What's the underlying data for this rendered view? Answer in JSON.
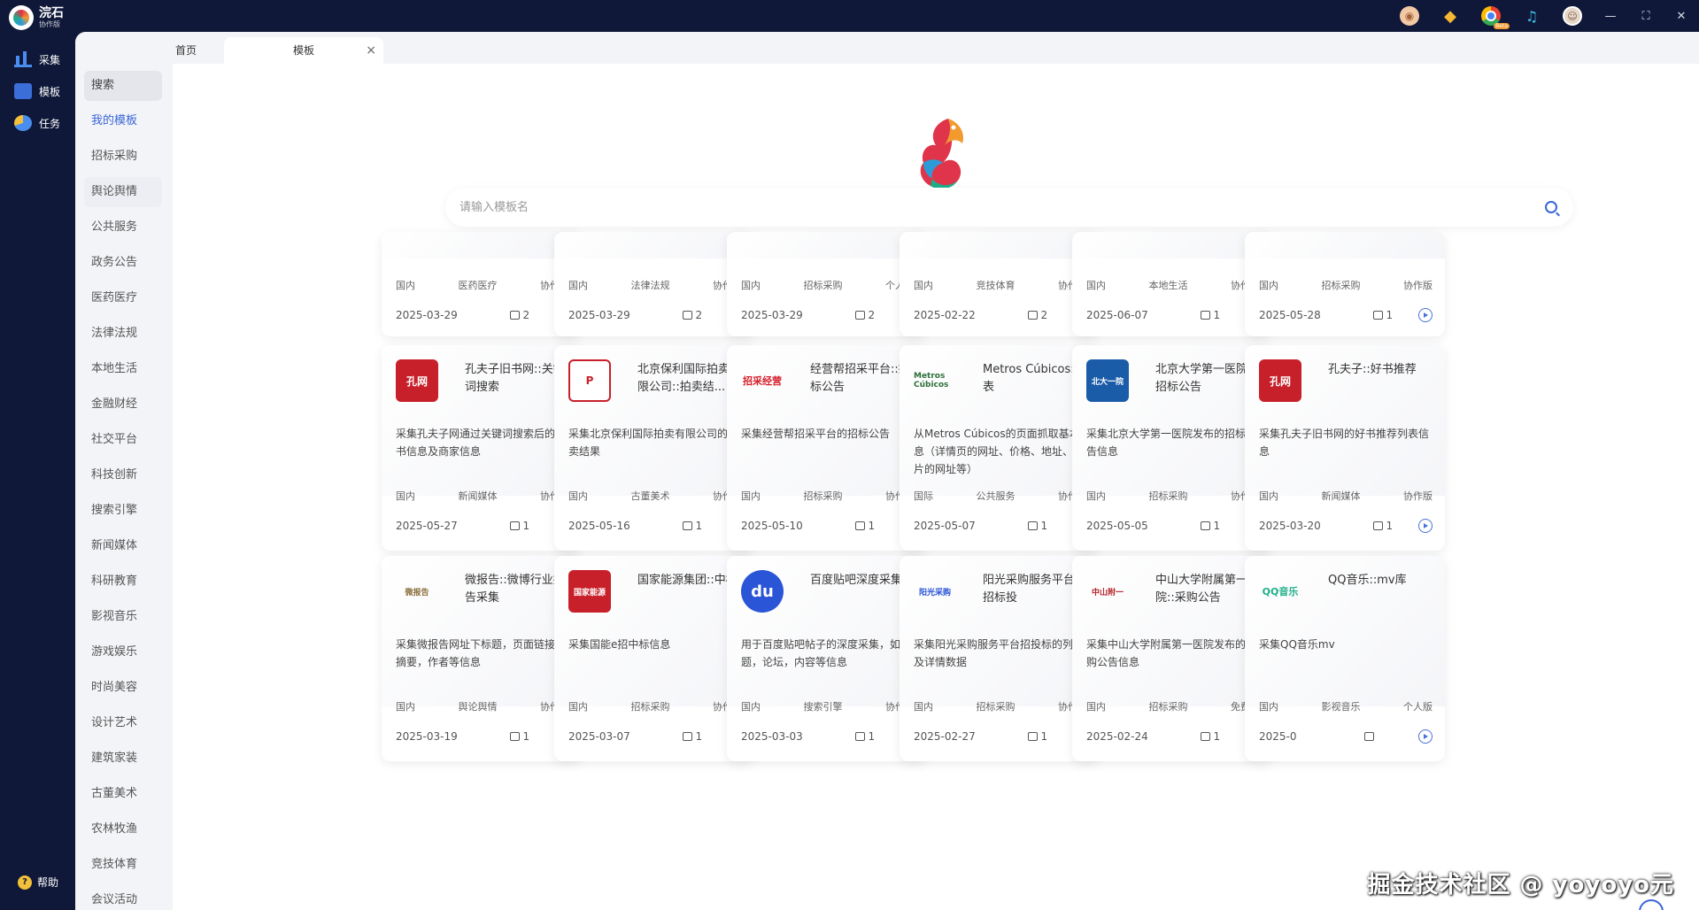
{
  "app": {
    "name": "浣石",
    "sub": "协作版"
  },
  "nav": [
    {
      "label": "采集",
      "icon": "chart-icon"
    },
    {
      "label": "模板",
      "icon": "template-icon"
    },
    {
      "label": "任务",
      "icon": "task-icon"
    }
  ],
  "help_label": "帮助",
  "tabs": {
    "home": "首页",
    "template": "模板",
    "close": "×"
  },
  "categories": [
    "搜索",
    "我的模板",
    "招标采购",
    "舆论舆情",
    "公共服务",
    "政务公告",
    "医药医疗",
    "法律法规",
    "本地生活",
    "金融财经",
    "社交平台",
    "科技创新",
    "搜索引擎",
    "新闻媒体",
    "科研教育",
    "影视音乐",
    "游戏娱乐",
    "时尚美容",
    "设计艺术",
    "建筑家装",
    "古董美术",
    "农林牧渔",
    "竞技体育",
    "会议活动"
  ],
  "search": {
    "placeholder": "请输入模板名"
  },
  "row0": [
    {
      "tags": [
        "国内",
        "医药医疗",
        "协作版"
      ],
      "date": "2025-03-29",
      "likes": "2"
    },
    {
      "tags": [
        "国内",
        "法律法规",
        "协作版"
      ],
      "date": "2025-03-29",
      "likes": "2"
    },
    {
      "tags": [
        "国内",
        "招标采购",
        "个人版"
      ],
      "date": "2025-03-29",
      "likes": "2"
    },
    {
      "tags": [
        "国内",
        "竞技体育",
        "协作版"
      ],
      "date": "2025-02-22",
      "likes": "2"
    },
    {
      "tags": [
        "国内",
        "本地生活",
        "协作版"
      ],
      "date": "2025-06-07",
      "likes": "1"
    },
    {
      "tags": [
        "国内",
        "招标采购",
        "协作版"
      ],
      "date": "2025-05-28",
      "likes": "1"
    }
  ],
  "row1": [
    {
      "logo": "孔网",
      "title": "孔夫子旧书网::关键词搜索",
      "desc": "采集孔夫子网通过关键词搜索后的图书信息及商家信息",
      "tags": [
        "国内",
        "新闻媒体",
        "协作版"
      ],
      "date": "2025-05-27",
      "likes": "1"
    },
    {
      "logo": "P",
      "title": "北京保利国际拍卖有限公司::拍卖结...",
      "desc": "采集北京保利国际拍卖有限公司的拍卖结果",
      "tags": [
        "国内",
        "古董美术",
        "协作版"
      ],
      "date": "2025-05-16",
      "likes": "1"
    },
    {
      "logo": "招采经营",
      "title": "经营帮招采平台::招标公告",
      "desc": "采集经营帮招采平台的招标公告",
      "tags": [
        "国内",
        "招标采购",
        "协作版"
      ],
      "date": "2025-05-10",
      "likes": "1"
    },
    {
      "logo": "Metros Cúbicos",
      "title": "Metros Cúbicos::列表",
      "desc": "从Metros Cúbicos的页面抓取基本信息（详情页的网址、价格、地址、图片的网址等）",
      "tags": [
        "国际",
        "公共服务",
        "协作版"
      ],
      "date": "2025-05-07",
      "likes": "1"
    },
    {
      "logo": "北大一院",
      "title": "北京大学第一医院::招标公告",
      "desc": "采集北京大学第一医院发布的招标公告信息",
      "tags": [
        "国内",
        "招标采购",
        "协作版"
      ],
      "date": "2025-05-05",
      "likes": "1"
    },
    {
      "logo": "孔网",
      "title": "孔夫子::好书推荐",
      "desc": "采集孔夫子旧书网的好书推荐列表信息",
      "tags": [
        "国内",
        "新闻媒体",
        "协作版"
      ],
      "date": "2025-03-20",
      "likes": "1"
    }
  ],
  "row2": [
    {
      "logo": "微报告",
      "title": "微报告::微博行业报告采集",
      "desc": "采集微报告网址下标题，页面链接，摘要，作者等信息",
      "tags": [
        "国内",
        "舆论舆情",
        "协作版"
      ],
      "date": "2025-03-19",
      "likes": "1"
    },
    {
      "logo": "国家能源",
      "title": "国家能源集团::中标",
      "desc": "采集国能e招中标信息",
      "tags": [
        "国内",
        "招标采购",
        "协作版"
      ],
      "date": "2025-03-07",
      "likes": "1"
    },
    {
      "logo": "du",
      "title": "百度贴吧深度采集",
      "desc": "用于百度贴吧帖子的深度采集，如标题，论坛，内容等信息",
      "tags": [
        "国内",
        "搜索引擎",
        "协作版"
      ],
      "date": "2025-03-03",
      "likes": "1"
    },
    {
      "logo": "阳光采购",
      "title": "阳光采购服务平台::招标投",
      "desc": "采集阳光采购服务平台招投标的列表及详情数据",
      "tags": [
        "国内",
        "招标采购",
        "协作版"
      ],
      "date": "2025-02-27",
      "likes": "1"
    },
    {
      "logo": "中山附一",
      "title": "中山大学附属第一医院::采购公告",
      "desc": "采集中山大学附属第一医院发布的采购公告信息",
      "tags": [
        "国内",
        "招标采购",
        "免费版"
      ],
      "date": "2025-02-24",
      "likes": "1"
    },
    {
      "logo": "QQ音乐",
      "title": "QQ音乐::mv库",
      "desc": "采集QQ音乐mv",
      "tags": [
        "国内",
        "影视音乐",
        "个人版"
      ],
      "date": "2025-0",
      "likes": ""
    }
  ],
  "watermark": "掘金技术社区 @ yoyoyo元",
  "colors": {
    "nav_bg": "#0f1838",
    "accent": "#3b66d6",
    "main_bg": "#ffffff",
    "cat_bg": "#f3f4f7"
  }
}
